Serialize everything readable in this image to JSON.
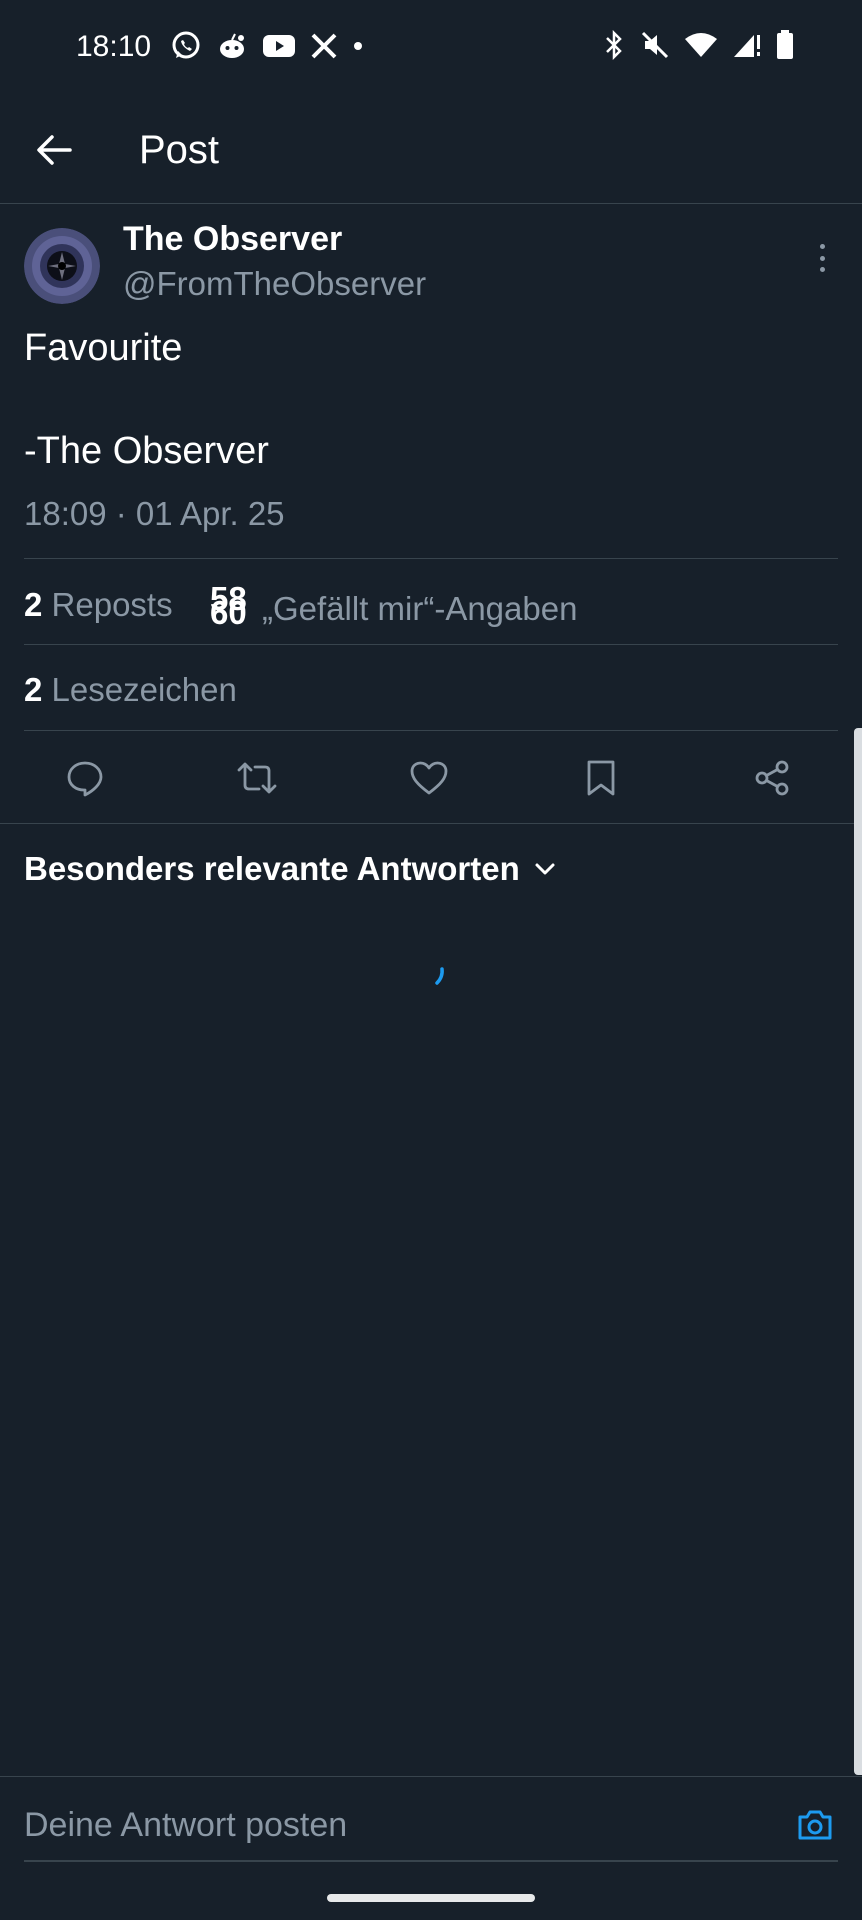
{
  "status_bar": {
    "time": "18:10",
    "left_icons": [
      "whatsapp-icon",
      "reddit-icon",
      "youtube-icon",
      "x-icon",
      "dot-icon"
    ],
    "right_icons": [
      "bluetooth-icon",
      "mute-icon",
      "wifi-icon",
      "signal-icon",
      "battery-icon"
    ]
  },
  "header": {
    "title": "Post"
  },
  "post": {
    "author_name": "The Observer",
    "author_handle": "@FromTheObserver",
    "text_line1": "Favourite",
    "text_line2": "-The Observer",
    "timestamp": "18:09 · 01 Apr. 25",
    "reposts_count": "2",
    "reposts_label": "Reposts",
    "likes_count_old": "58",
    "likes_count_new": "60",
    "likes_label": "„Gefällt mir“-Angaben",
    "bookmarks_count": "2",
    "bookmarks_label": "Lesezeichen"
  },
  "actions": [
    "reply",
    "repost",
    "like",
    "bookmark",
    "share"
  ],
  "replies": {
    "sort_label": "Besonders relevante Antworten"
  },
  "composer": {
    "placeholder": "Deine Antwort posten"
  },
  "colors": {
    "background": "#17202a",
    "muted_text": "#8b98a5",
    "divider": "#38444d",
    "accent": "#1d9bf0"
  }
}
